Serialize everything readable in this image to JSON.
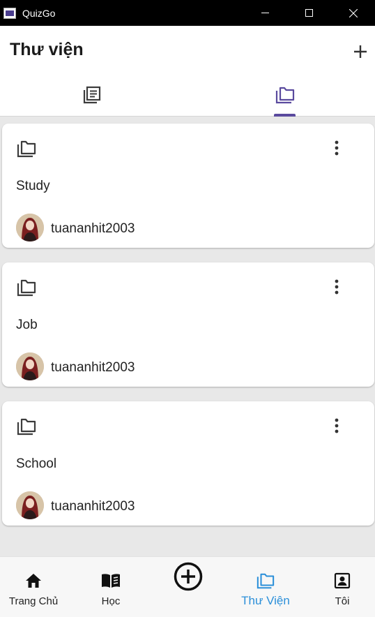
{
  "window": {
    "title": "QuizGo"
  },
  "header": {
    "title": "Thư viện"
  },
  "tabs": [
    {
      "icon": "study-sets-icon"
    },
    {
      "icon": "folders-icon",
      "active": true
    }
  ],
  "folders": [
    {
      "name": "Study",
      "owner": "tuananhit2003"
    },
    {
      "name": "Job",
      "owner": "tuananhit2003"
    },
    {
      "name": "School",
      "owner": "tuananhit2003"
    }
  ],
  "nav": {
    "home": "Trang Chủ",
    "learn": "Học",
    "library": "Thư Viện",
    "me": "Tôi"
  },
  "colors": {
    "accent": "#5a4a9e",
    "active_nav": "#2b8fd9"
  }
}
